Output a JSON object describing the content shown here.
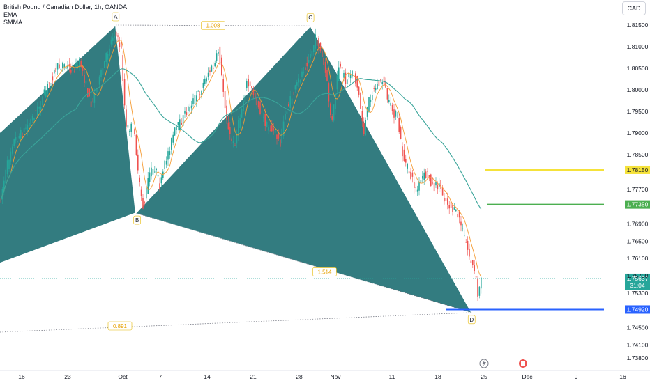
{
  "legend": {
    "title": "British Pound / Canadian Dollar, 1h, OANDA",
    "ema": "EMA",
    "smma": "SMMA"
  },
  "currency_button": "CAD",
  "colors": {
    "up": "#26a69a",
    "down": "#ef5350",
    "ema": "#f59c34",
    "smma": "#3aa59a",
    "pattern_fill": "#1d6e72",
    "level_yellow": "#f5e23a",
    "level_green": "#4caf50",
    "level_blue": "#2962ff",
    "price_tag": "#26a69a"
  },
  "icons": [
    "lightning-icon",
    "calendar-event-icon"
  ],
  "chart_data": {
    "type": "candlestick",
    "symbol": "British Pound / Canadian Dollar",
    "interval": "1h",
    "ylim": [
      1.7355,
      1.8185
    ],
    "y_ticks": [
      "1.81500",
      "1.81000",
      "1.80500",
      "1.80000",
      "1.79500",
      "1.79000",
      "1.78500",
      "1.78150",
      "1.77700",
      "1.77350",
      "1.76900",
      "1.76500",
      "1.76100",
      "1.75700",
      "1.75300",
      "1.74920",
      "1.74500",
      "1.74100",
      "1.73800"
    ],
    "x_ticks": [
      "16",
      "23",
      "Oct",
      "7",
      "14",
      "21",
      "28",
      "Nov",
      "11",
      "18",
      "25",
      "Dec",
      "9",
      "16"
    ],
    "pattern": {
      "points": [
        {
          "label": "A",
          "date": "2024-09-30",
          "price": 1.815
        },
        {
          "label": "B",
          "date": "2024-10-03",
          "price": 1.7715
        },
        {
          "label": "C",
          "date": "2024-10-29",
          "price": 1.8148
        },
        {
          "label": "D",
          "date": "2024-11-22",
          "price": 1.7485
        }
      ],
      "ratios": [
        "1.008",
        "1.514",
        "0.891"
      ]
    },
    "levels": [
      {
        "label": "1.78150",
        "price": 1.7815,
        "color": "yellow"
      },
      {
        "label": "1.77350",
        "price": 1.7735,
        "color": "green"
      },
      {
        "label": "1.74920",
        "price": 1.7492,
        "color": "blue"
      }
    ],
    "last_price": "1.75637",
    "countdown": "31:04",
    "partial_tag": "1.75700"
  }
}
